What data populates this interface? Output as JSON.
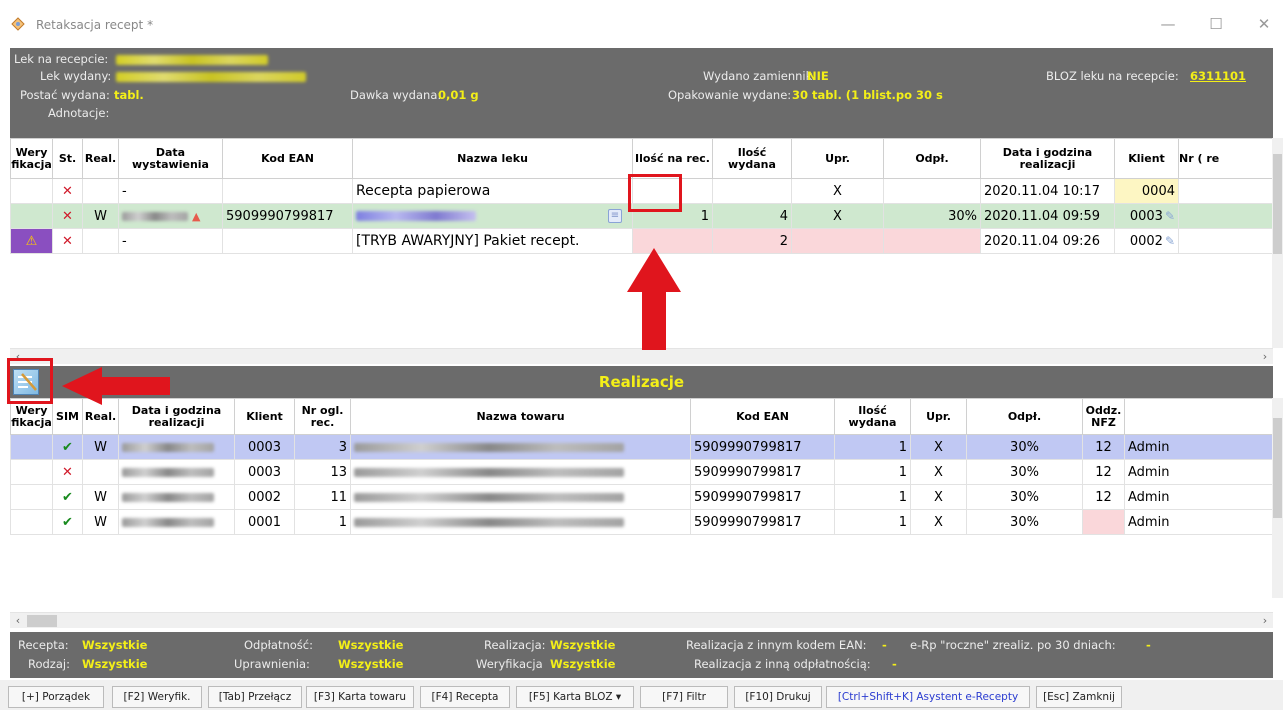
{
  "window": {
    "title": "Retaksacja recept *"
  },
  "info": {
    "lek_na_recepcie_label": "Lek na recepcie:",
    "lek_wydany_label": "Lek wydany:",
    "postac_label": "Postać wydana:",
    "postac_value": "tabl.",
    "dawka_label": "Dawka wydana:",
    "dawka_value": "0,01 g",
    "zamiennik_label": "Wydano zamiennik:",
    "zamiennik_value": "NIE",
    "opakowanie_label": "Opakowanie wydane:",
    "opakowanie_value": "30 tabl. (1 blist.po 30 s",
    "bloz_label": "BLOZ leku na recepcie:",
    "bloz_value": "6311101",
    "adnotacje_label": "Adnotacje:"
  },
  "grid1": {
    "headers": [
      "Wery fikacja",
      "St.",
      "Real.",
      "Data wystawienia",
      "Kod EAN",
      "Nazwa leku",
      "Ilość na rec.",
      "Ilość wydana",
      "Upr.",
      "Odpł.",
      "Data i godzina realizacji",
      "Klient",
      "Nr ( re"
    ],
    "rows": [
      {
        "status": "✕",
        "real": "",
        "data": "-",
        "ean": "",
        "nazwa": "Recepta papierowa",
        "ilosc_rec": "",
        "ilosc_wyd": "",
        "upr": "X",
        "odpl": "",
        "data_real": "2020.11.04 10:17",
        "klient": "0004"
      },
      {
        "status": "✕",
        "real": "W",
        "data": "",
        "ean": "5909990799817",
        "nazwa": "",
        "ilosc_rec": "1",
        "ilosc_wyd": "4",
        "upr": "X",
        "odpl": "30%",
        "data_real": "2020.11.04 09:59",
        "klient": "0003"
      },
      {
        "status": "✕",
        "real": "",
        "data": "-",
        "ean": "",
        "nazwa": "[TRYB AWARYJNY] Pakiet recept.",
        "ilosc_rec": "",
        "ilosc_wyd": "2",
        "upr": "",
        "odpl": "",
        "data_real": "2020.11.04 09:26",
        "klient": "0002"
      }
    ]
  },
  "realizacje": {
    "title": "Realizacje",
    "headers": [
      "Wery fikacja",
      "SIM",
      "Real.",
      "Data i godzina realizacji",
      "Klient",
      "Nr ogl. rec.",
      "Nazwa towaru",
      "Kod EAN",
      "Ilość wydana",
      "Upr.",
      "Odpł.",
      "Oddz. NFZ",
      ""
    ],
    "rows": [
      {
        "sim": "✔",
        "real": "W",
        "klient": "0003",
        "nr": "3",
        "ean": "5909990799817",
        "ilosc": "1",
        "upr": "X",
        "odpl": "30%",
        "nfz": "12",
        "user": "Admin"
      },
      {
        "sim": "✕",
        "real": "",
        "klient": "0003",
        "nr": "13",
        "ean": "5909990799817",
        "ilosc": "1",
        "upr": "X",
        "odpl": "30%",
        "nfz": "12",
        "user": "Admin"
      },
      {
        "sim": "✔",
        "real": "W",
        "klient": "0002",
        "nr": "11",
        "ean": "5909990799817",
        "ilosc": "1",
        "upr": "X",
        "odpl": "30%",
        "nfz": "12",
        "user": "Admin"
      },
      {
        "sim": "✔",
        "real": "W",
        "klient": "0001",
        "nr": "1",
        "ean": "5909990799817",
        "ilosc": "1",
        "upr": "X",
        "odpl": "30%",
        "nfz": "",
        "user": "Admin"
      }
    ]
  },
  "filters": {
    "recepta_label": "Recepta:",
    "recepta_value": "Wszystkie",
    "rodzaj_label": "Rodzaj:",
    "rodzaj_value": "Wszystkie",
    "odplatnosc_label": "Odpłatność:",
    "odplatnosc_value": "Wszystkie",
    "uprawnienia_label": "Uprawnienia:",
    "uprawnienia_value": "Wszystkie",
    "realizacja_label": "Realizacja:",
    "realizacja_value": "Wszystkie",
    "weryfikacja_label": "Weryfikacja",
    "weryfikacja_value": "Wszystkie",
    "inny_ean_label": "Realizacja z innym kodem EAN:",
    "inny_ean_value": "-",
    "inna_odpl_label": "Realizacja z inną odpłatnością:",
    "inna_odpl_value": "-",
    "roczne_label": "e-Rp \"roczne\" zrealiz. po 30 dniach:",
    "roczne_value": "-"
  },
  "buttons": {
    "porzadek": "[+] Porządek",
    "weryfik": "[F2] Weryfik.",
    "przelacz": "[Tab] Przełącz",
    "karta_towaru": "[F3] Karta towaru",
    "recepta": "[F4] Recepta",
    "karta_bloz": "[F5] Karta BLOZ ▾",
    "filtr": "[F7] Filtr",
    "drukuj": "[F10] Drukuj",
    "asystent": "[Ctrl+Shift+K] Asystent e-Recepty",
    "zamknij": "[Esc] Zamknij"
  }
}
